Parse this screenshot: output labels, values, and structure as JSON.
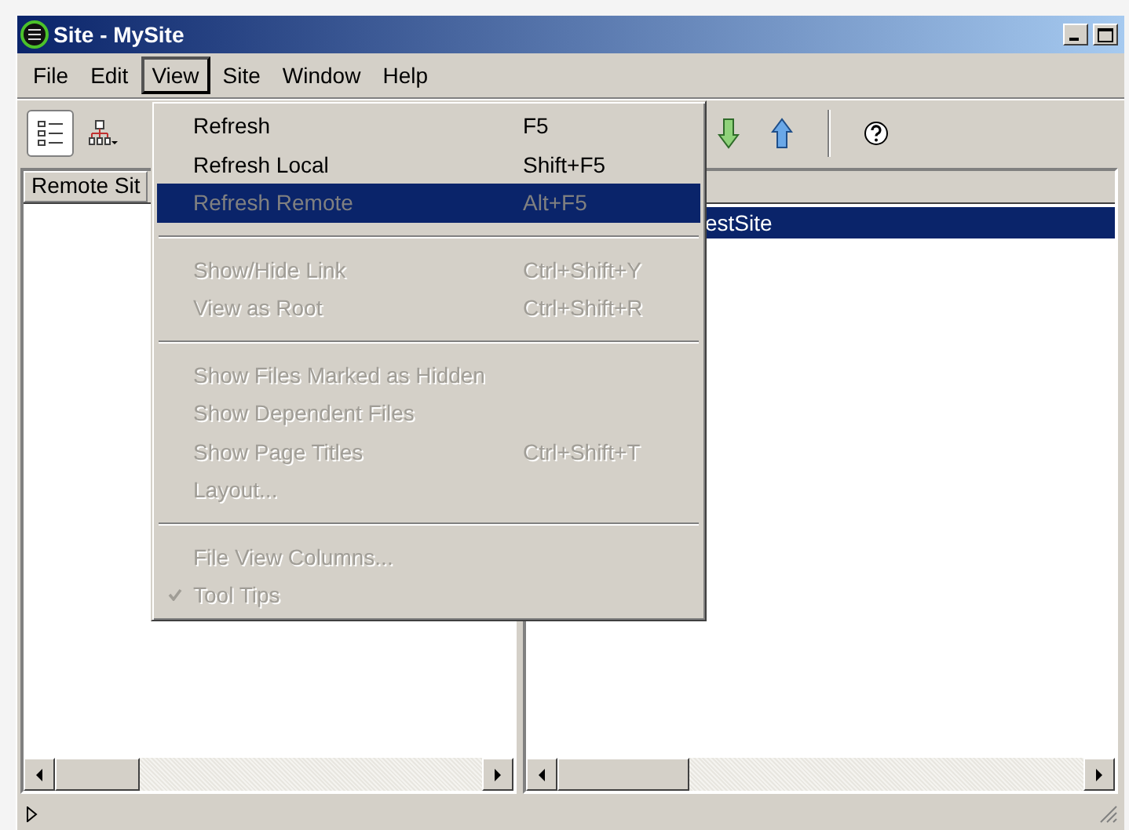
{
  "window": {
    "title": "Site - MySite"
  },
  "menubar": [
    {
      "label": "File",
      "selected": false
    },
    {
      "label": "Edit",
      "selected": false
    },
    {
      "label": "View",
      "selected": true
    },
    {
      "label": "Site",
      "selected": false
    },
    {
      "label": "Window",
      "selected": false
    },
    {
      "label": "Help",
      "selected": false
    }
  ],
  "view_menu": [
    {
      "kind": "item",
      "label": "Refresh",
      "shortcut": "F5",
      "disabled": false,
      "selected": false
    },
    {
      "kind": "item",
      "label": "Refresh Local",
      "shortcut": "Shift+F5",
      "disabled": false,
      "selected": false
    },
    {
      "kind": "item",
      "label": "Refresh Remote",
      "shortcut": "Alt+F5",
      "disabled": true,
      "selected": true
    },
    {
      "kind": "separator"
    },
    {
      "kind": "item",
      "label": "Show/Hide Link",
      "shortcut": "Ctrl+Shift+Y",
      "disabled": true,
      "selected": false
    },
    {
      "kind": "item",
      "label": "View as Root",
      "shortcut": "Ctrl+Shift+R",
      "disabled": true,
      "selected": false
    },
    {
      "kind": "separator"
    },
    {
      "kind": "item",
      "label": "Show Files Marked as Hidden",
      "disabled": true,
      "selected": false
    },
    {
      "kind": "item",
      "label": "Show Dependent Files",
      "disabled": true,
      "selected": false
    },
    {
      "kind": "item",
      "label": "Show Page Titles",
      "shortcut": "Ctrl+Shift+T",
      "disabled": true,
      "selected": false
    },
    {
      "kind": "item",
      "label": "Layout...",
      "disabled": true,
      "selected": false
    },
    {
      "kind": "separator"
    },
    {
      "kind": "item",
      "label": "File View Columns...",
      "disabled": true,
      "selected": false
    },
    {
      "kind": "item",
      "label": "Tool Tips",
      "disabled": true,
      "selected": false,
      "checked": true
    }
  ],
  "toolbar": {
    "left": [
      {
        "kind": "list",
        "pressed": true
      },
      {
        "kind": "sitemap",
        "pressed": false
      }
    ],
    "right": [
      {
        "kind": "get",
        "pressed": false
      },
      {
        "kind": "put",
        "pressed": false
      },
      {
        "kind": "separator"
      },
      {
        "kind": "help",
        "pressed": false
      }
    ]
  },
  "left_panel": {
    "header": "Remote Sit"
  },
  "right_panel": {
    "rows": [
      {
        "label": "estSite",
        "selected": true
      }
    ]
  }
}
